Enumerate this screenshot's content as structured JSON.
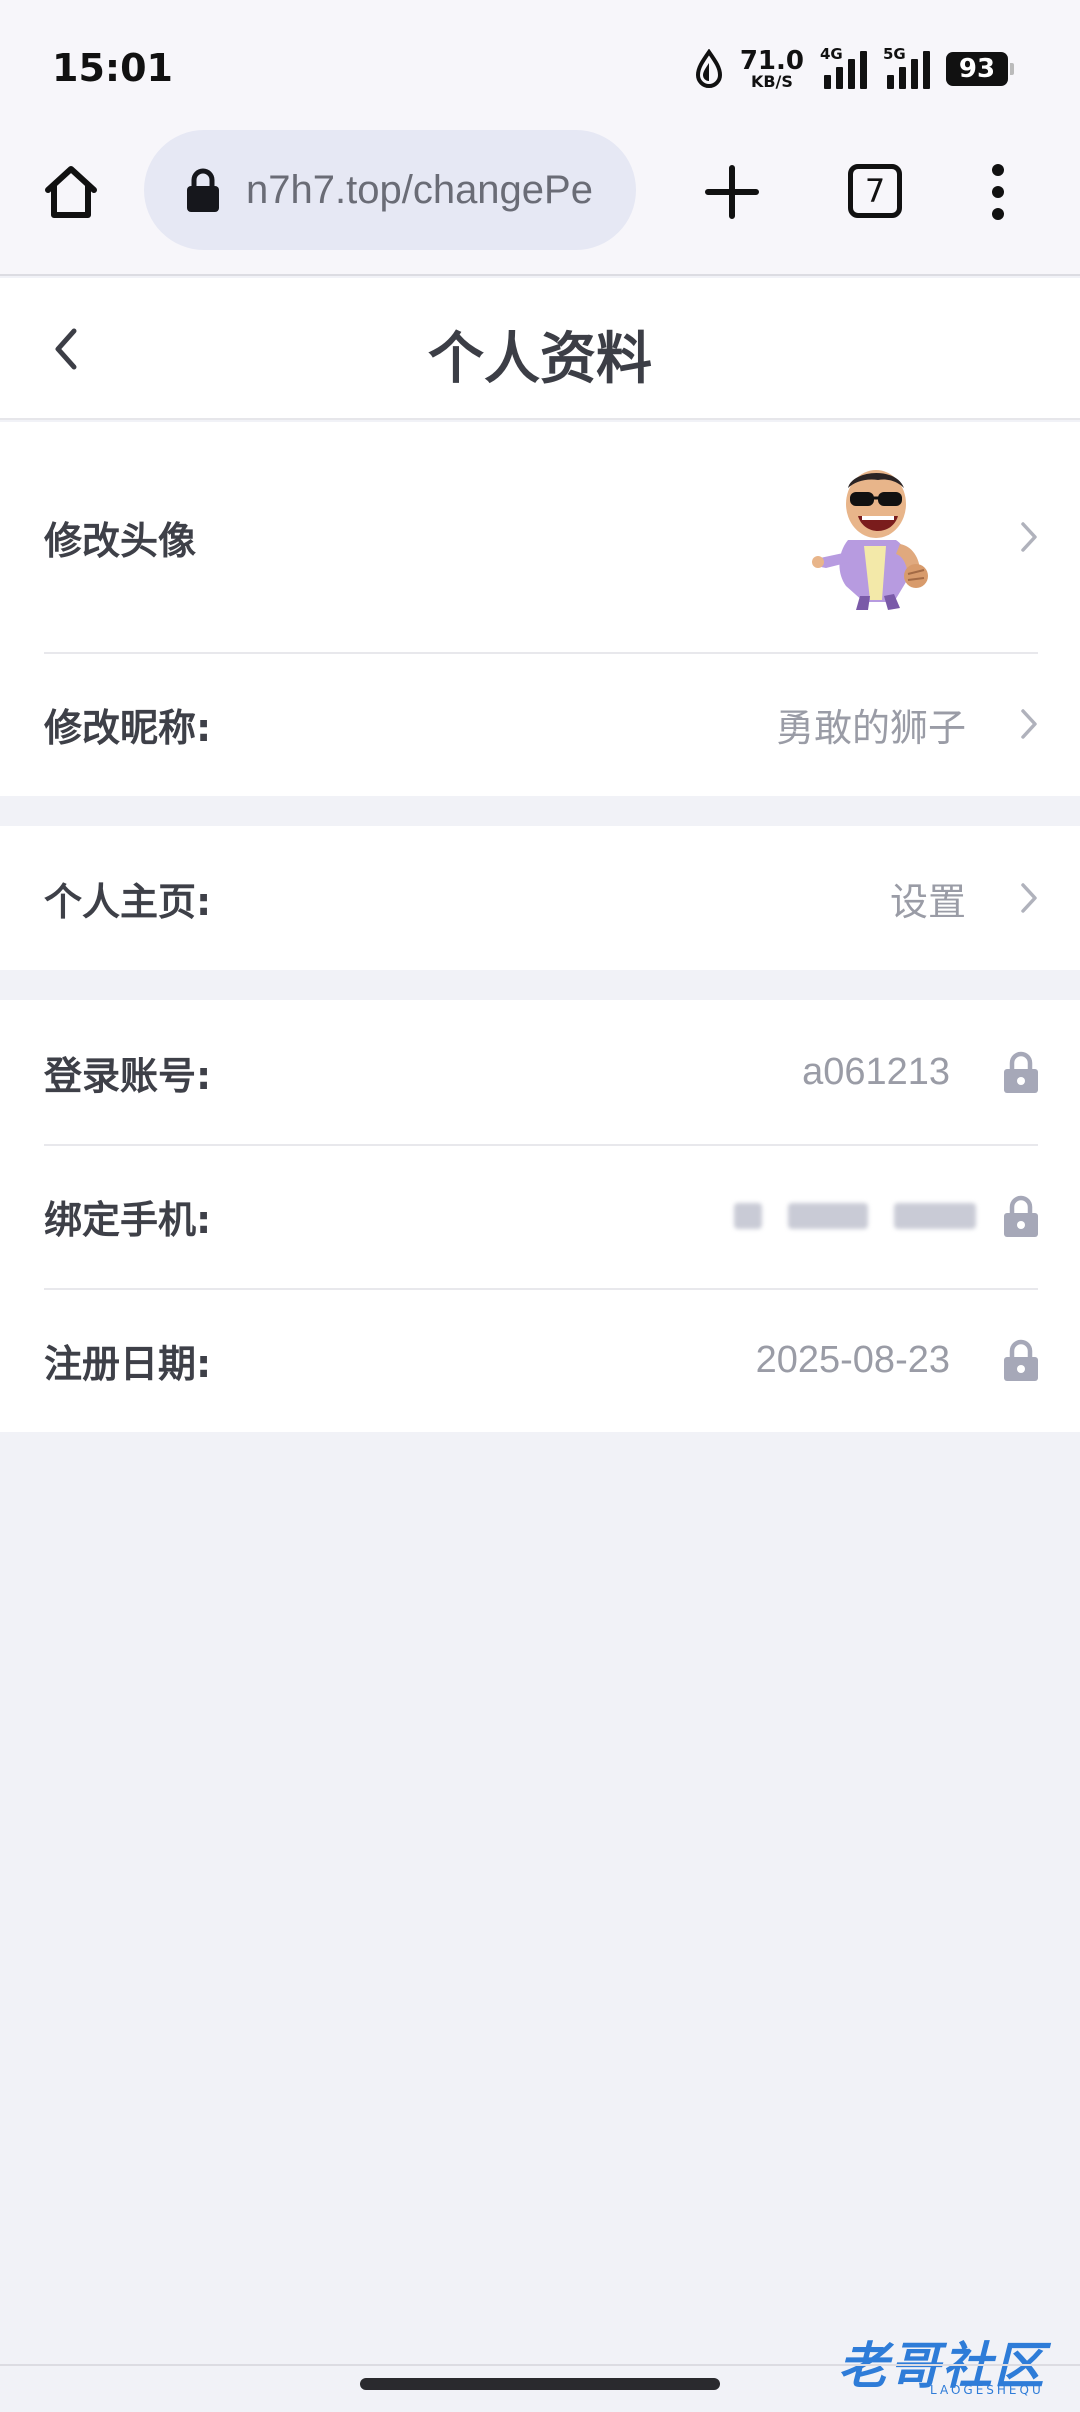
{
  "status_bar": {
    "time": "15:01",
    "net_speed_value": "71.0",
    "net_speed_unit": "KB/S",
    "signal_1_label": "4G",
    "signal_2_label": "5G",
    "battery": "93"
  },
  "browser": {
    "url": "n7h7.top/changePe",
    "tab_count": "7"
  },
  "header": {
    "title": "个人资料"
  },
  "profile": {
    "avatar_label": "修改头像",
    "nickname_label": "修改昵称:",
    "nickname_value": "勇敢的狮子",
    "homepage_label": "个人主页:",
    "homepage_value": "设置",
    "account_label": "登录账号:",
    "account_value": "a061213",
    "phone_label": "绑定手机:",
    "register_label": "注册日期:",
    "register_value": "2025-08-23"
  },
  "watermark": {
    "text": "老哥社区",
    "sub": "LAOGESHEQU"
  },
  "colors": {
    "page_bg": "#f1f2f7",
    "url_bg": "#e6e8f4",
    "muted_text": "#9a9ca6",
    "lock_color": "#a6a8b8"
  }
}
